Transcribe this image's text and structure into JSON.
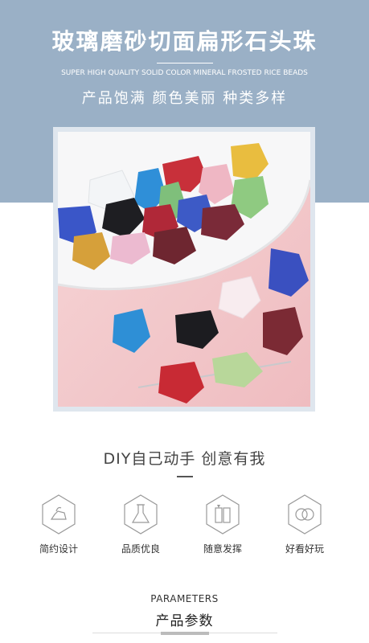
{
  "header": {
    "title": "玻璃磨砂切面扁形石头珠",
    "subtitle_en": "SUPER HIGH QUALITY SOLID COLOR MINERAL FROSTED RICE BEADS",
    "tagline": "产品饱满 颜色美丽 种类多样",
    "band_color": "#9ab0c6"
  },
  "photo": {
    "description_icon": "frosted-glass-beads-photo"
  },
  "diy": {
    "title": "DIY自己动手 创意有我"
  },
  "features": [
    {
      "label": "简约设计",
      "icon": "iron-icon"
    },
    {
      "label": "品质优良",
      "icon": "flask-icon"
    },
    {
      "label": "随意发挥",
      "icon": "palette-icon"
    },
    {
      "label": "好看好玩",
      "icon": "rings-icon"
    }
  ],
  "parameters": {
    "title_en": "PARAMETERS",
    "title_cn": "产品参数"
  }
}
